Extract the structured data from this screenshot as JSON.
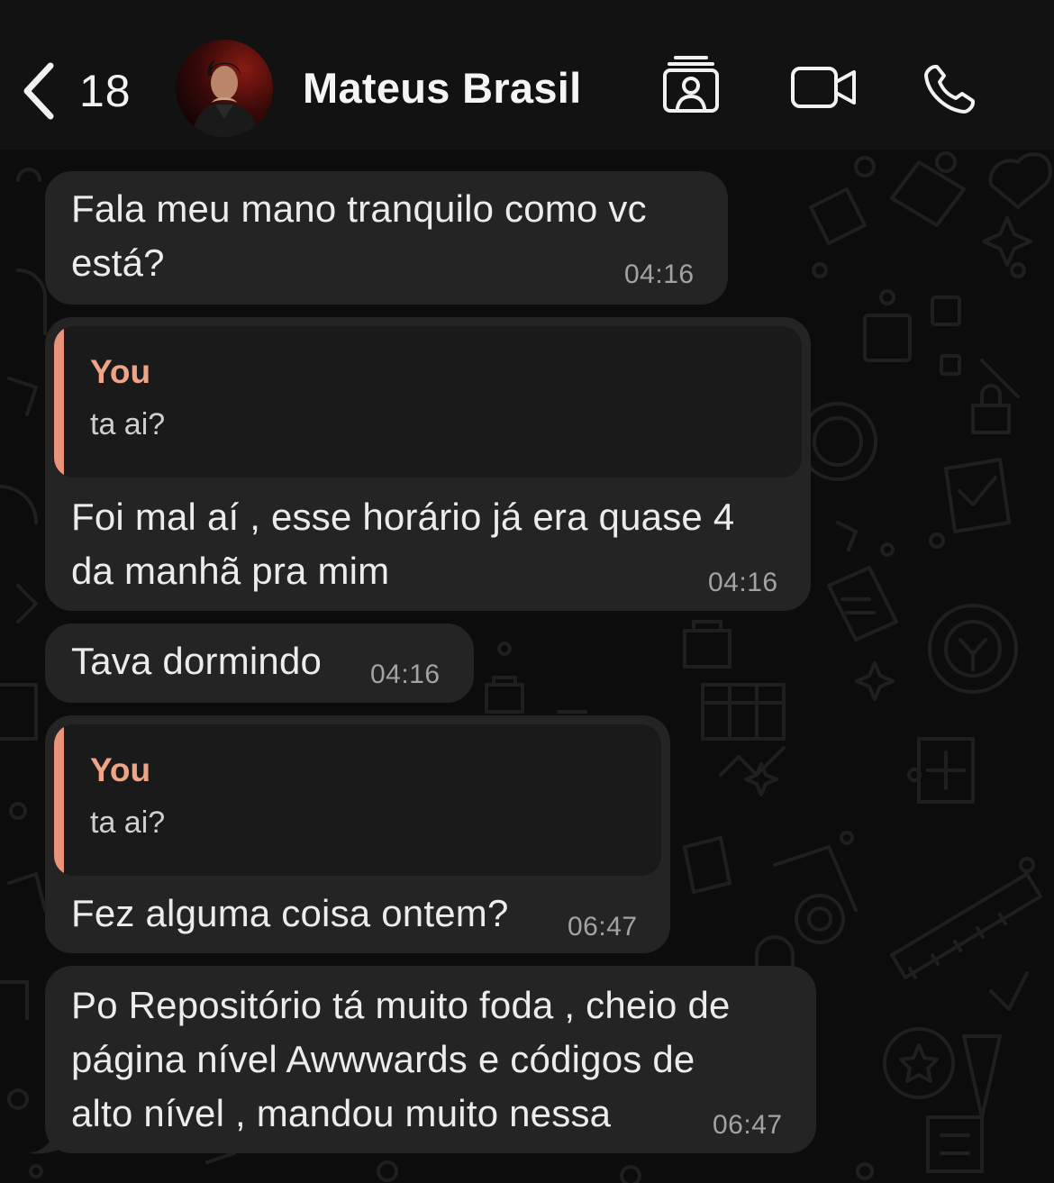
{
  "header": {
    "back_count": "18",
    "contact_name": "Mateus Brasil",
    "icons": [
      "chevron-left-icon",
      "contact-card-icon",
      "video-camera-icon",
      "phone-icon"
    ]
  },
  "theme": {
    "bubble_color": "#242424",
    "quote_accent": "#e9937a",
    "quote_author_color": "#eda487"
  },
  "messages": [
    {
      "lines": [
        "Fala meu mano tranquilo como vc",
        "está?"
      ],
      "time": "04:16"
    },
    {
      "reply": {
        "author": "You",
        "text": "ta ai?"
      },
      "lines": [
        "Foi mal aí , esse horário já era quase 4",
        "da manhã pra mim"
      ],
      "time": "04:16"
    },
    {
      "lines": [
        "Tava dormindo"
      ],
      "time": "04:16"
    },
    {
      "reply": {
        "author": "You",
        "text": "ta ai?"
      },
      "lines": [
        "Fez alguma coisa ontem?"
      ],
      "time": "06:47"
    },
    {
      "lines": [
        "Po Repositório tá muito foda , cheio de",
        "página nível Awwwards e códigos de",
        "alto nível , mandou muito nessa"
      ],
      "time": "06:47"
    }
  ]
}
